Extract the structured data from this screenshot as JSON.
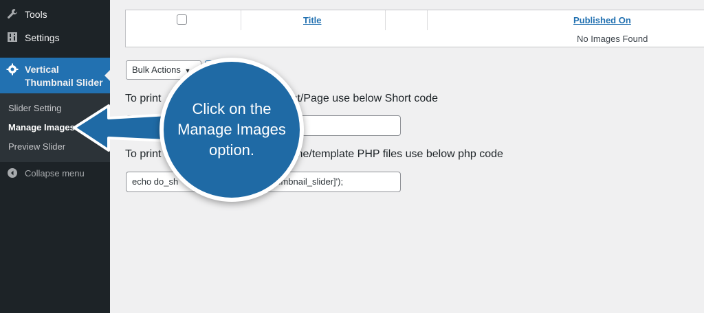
{
  "sidebar": {
    "items": [
      {
        "label": "Tools",
        "icon": "wrench-icon"
      },
      {
        "label": "Settings",
        "icon": "settings-sliders-icon"
      },
      {
        "label": "Vertical Thumbnail Slider",
        "icon": "gear-icon"
      }
    ],
    "submenu": [
      {
        "label": "Slider Setting"
      },
      {
        "label": "Manage Images"
      },
      {
        "label": "Preview Slider"
      }
    ],
    "collapse_label": "Collapse menu"
  },
  "table": {
    "col_title": "Title",
    "col_published": "Published On",
    "empty_message": "No Images Found"
  },
  "bulk_actions": {
    "selected": "Bulk Actions"
  },
  "instructions": {
    "post_heading_left": "To print",
    "post_heading_right": "s Post/Page use below Short code",
    "php_heading_left": "To print",
    "php_heading_right": "s theme/template PHP files use below php code",
    "php_code_left": "echo do_sh",
    "php_code_right": "humbnail_slider]');"
  },
  "callout": {
    "text": "Click on the Manage Images option.",
    "color": "#1f6aa5"
  },
  "colors": {
    "sidebar_bg": "#1d2327",
    "active_bg": "#2271b1",
    "link": "#2271b1"
  }
}
